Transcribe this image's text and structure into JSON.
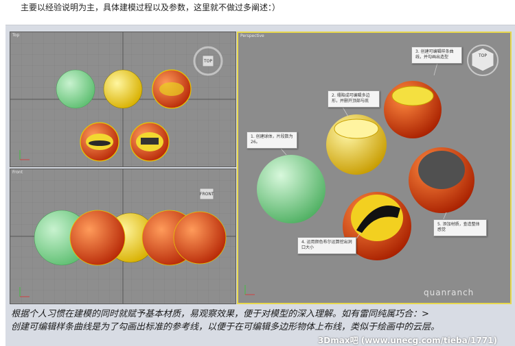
{
  "intro_text": "主要以经验说明为主，具体建模过程以及参数，这里就不做过多阐述：）",
  "viewports": {
    "top_label": "Top",
    "front_label": "Front",
    "persp_label": "Perspective",
    "top_cube": "TOP",
    "front_cube": "FRONT",
    "persp_cube": "TOP"
  },
  "callouts": {
    "step1": "1. 创建球体，片段数为26。",
    "step2": "2. 塌陷成可编辑多边形，并删开顶部与底",
    "step3": "3. 创建可编辑样条曲线，并勾画出造型",
    "step4": "4. 运用颜色布尔运算挖出洞口大小",
    "step5": "5. 添加材质，查造整体感觉"
  },
  "caption": {
    "line1": "根据个人习惯在建模的同时就赋予基本材质，易观察效果，便于对模型的深入理解。如有雷同纯属巧合：>",
    "line2": "创建可编辑样条曲线是为了勾画出标准的参考线，以便于在可编辑多边形物体上布线，类似于绘画中的云层。"
  },
  "watermark": "quanranch",
  "footer_mark": "3Dmax吧 (www.unecg.com/tieba/1771)",
  "colors": {
    "viewport_bg": "#8e8e8e",
    "active_border": "#e8d84c",
    "green_sphere": "#7fd48f",
    "yellow_sphere": "#f0d020",
    "red_sphere": "#d63a10"
  }
}
